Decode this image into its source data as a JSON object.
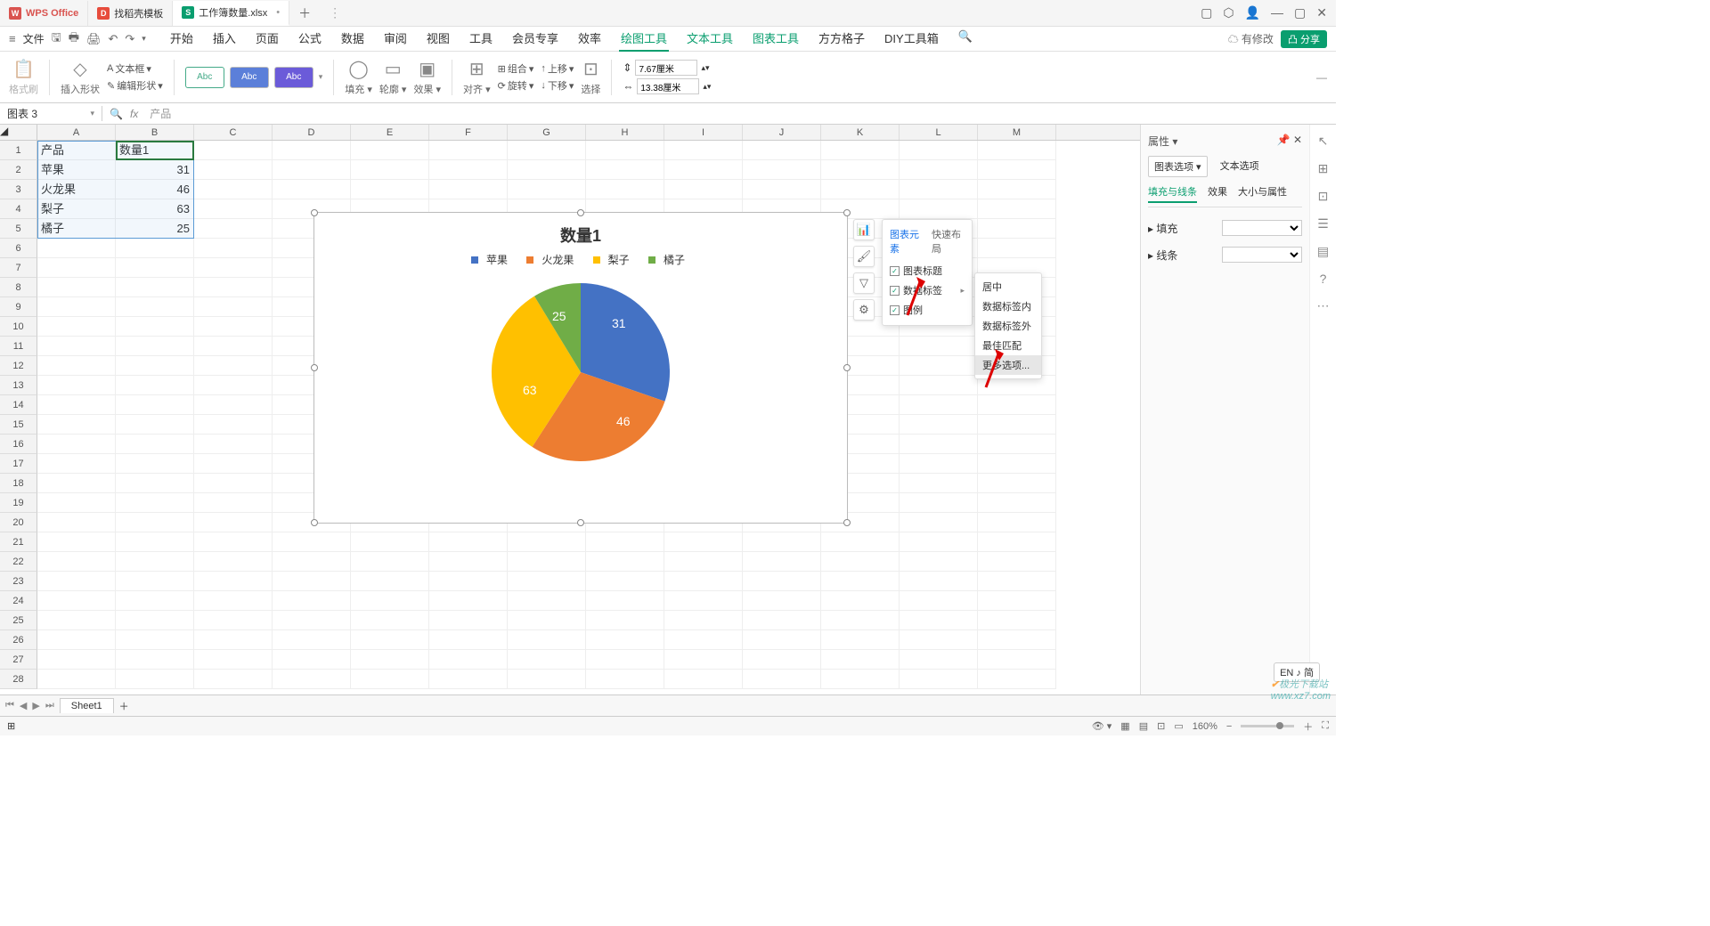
{
  "titlebar": {
    "app": "WPS Office",
    "tab1": "找稻壳模板",
    "tab2": "工作簿数量.xlsx"
  },
  "menubar": {
    "file": "文件",
    "items": [
      "开始",
      "插入",
      "页面",
      "公式",
      "数据",
      "审阅",
      "视图",
      "工具",
      "会员专享",
      "效率",
      "绘图工具",
      "文本工具",
      "图表工具",
      "方方格子",
      "DIY工具箱"
    ],
    "active": "绘图工具",
    "modify": "有修改",
    "share": "分享"
  },
  "ribbon": {
    "format_painter": "格式刷",
    "insert_shape": "插入形状",
    "text_box": "文本框",
    "edit_shape": "编辑形状",
    "abc": "Abc",
    "fill": "填充",
    "outline": "轮廓",
    "effects": "效果",
    "align": "对齐",
    "group": "组合",
    "rotate": "旋转",
    "up": "上移",
    "down": "下移",
    "select": "选择",
    "w": "7.67厘米",
    "h": "13.38厘米"
  },
  "namebox": "图表 3",
  "formula": "产品",
  "cols": [
    "A",
    "B",
    "C",
    "D",
    "E",
    "F",
    "G",
    "H",
    "I",
    "J",
    "K",
    "L",
    "M"
  ],
  "data_rows": [
    [
      "产品",
      "数量1"
    ],
    [
      "苹果",
      "31"
    ],
    [
      "火龙果",
      "46"
    ],
    [
      "梨子",
      "63"
    ],
    [
      "橘子",
      "25"
    ]
  ],
  "chart_data": {
    "type": "pie",
    "title": "数量1",
    "categories": [
      "苹果",
      "火龙果",
      "梨子",
      "橘子"
    ],
    "values": [
      31,
      46,
      63,
      25
    ],
    "colors": [
      "#4472c4",
      "#ed7d31",
      "#ffc000",
      "#70ad47"
    ]
  },
  "popup1": {
    "tab1": "图表元素",
    "tab2": "快速布局",
    "i1": "图表标题",
    "i2": "数据标签",
    "i3": "图例"
  },
  "popup2": {
    "i1": "居中",
    "i2": "数据标签内",
    "i3": "数据标签外",
    "i4": "最佳匹配",
    "i5": "更多选项..."
  },
  "rpanel": {
    "title": "属性",
    "tab1": "图表选项",
    "tab2": "文本选项",
    "st1": "填充与线条",
    "st2": "效果",
    "st3": "大小与属性",
    "sec1": "填充",
    "sec2": "线条"
  },
  "sheet": {
    "name": "Sheet1"
  },
  "statusbar": {
    "ime": "EN ♪ 简",
    "zoom": "160%"
  },
  "watermark_site": "www.xz7.com",
  "watermark_brand": "极光下载站"
}
